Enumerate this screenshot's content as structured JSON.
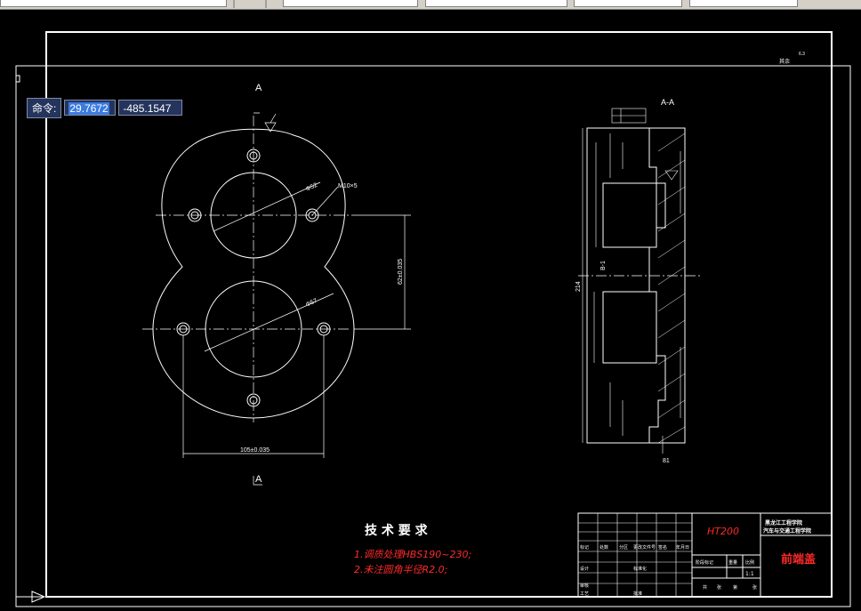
{
  "command_prompt": {
    "label": "命令:",
    "x_value": "29.7672",
    "y_value": "-485.1547"
  },
  "drawing": {
    "section_a_top": "A",
    "section_a_bottom": "A",
    "section_view_label": "A-A",
    "hole_note": "M10×5",
    "roughness_other": "其余",
    "roughness_value": "6.3",
    "dim_horizontal_bottom": "105±0.035",
    "dim_vertical_center": "62±0.035",
    "dim_dia_top": "Φ52",
    "dim_dia_bottom": "Φ57",
    "dim_height_total": "214",
    "dim_bottom_width": "81",
    "section_mark": "B-1"
  },
  "tech_requirements": {
    "title": "技 术 要 求",
    "items": [
      "1.调质处理HBS190~230;",
      "2.未注圆角半径R2.0;"
    ]
  },
  "title_block": {
    "material": "HT200",
    "school_line1": "黑龙江工程学院",
    "school_line2": "汽车与交通工程学院",
    "part_name": "前端盖",
    "scale": "1:1",
    "labels": [
      "标记",
      "处数",
      "分区",
      "更改文件号",
      "签名",
      "年月日",
      "设计",
      "标准化",
      "审核",
      "工艺",
      "批准",
      "阶段标记",
      "重量",
      "比例",
      "共",
      "张",
      "第",
      "张"
    ]
  },
  "colors": {
    "background": "#000000",
    "lines": "#ffffff",
    "red_text": "#ff2a2a",
    "command_bg": "#24345c",
    "command_highlight": "#3b7be0"
  }
}
